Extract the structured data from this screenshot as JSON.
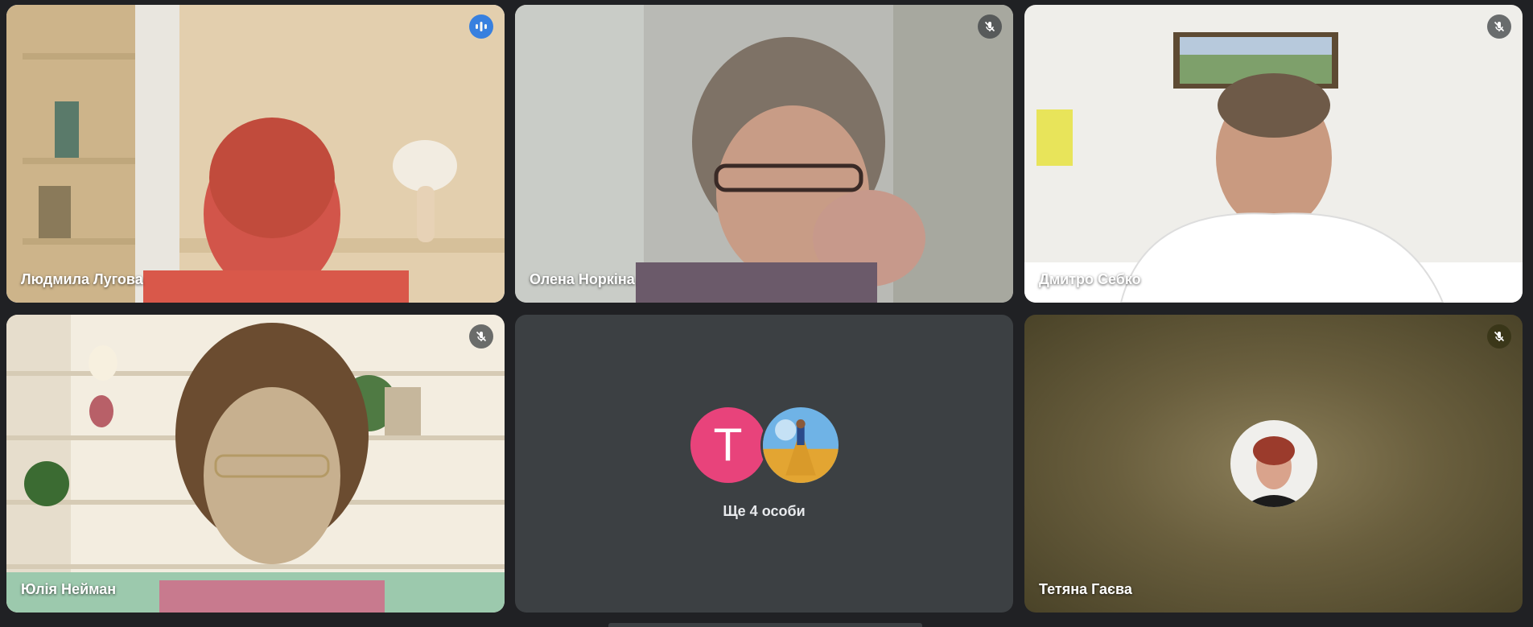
{
  "participants": [
    {
      "name": "Людмила Лугова",
      "state": "speaking",
      "icon": "audio-bars-icon"
    },
    {
      "name": "Олена Норкіна",
      "state": "muted",
      "icon": "mic-off-icon"
    },
    {
      "name": "Дмитро Себко",
      "state": "muted",
      "icon": "mic-off-icon"
    },
    {
      "name": "Юлія Нейман",
      "state": "muted",
      "icon": "mic-off-icon"
    },
    {
      "name": "Тетяна Гаєва",
      "state": "muted",
      "icon": "mic-off-icon"
    }
  ],
  "overflow": {
    "label": "Ще 4 особи",
    "avatar_letter": "T",
    "avatar_color": "#e8437b"
  },
  "colors": {
    "background": "#202124",
    "speaking_outline": "#a8c7fa",
    "tile_dark": "#3c4043"
  }
}
